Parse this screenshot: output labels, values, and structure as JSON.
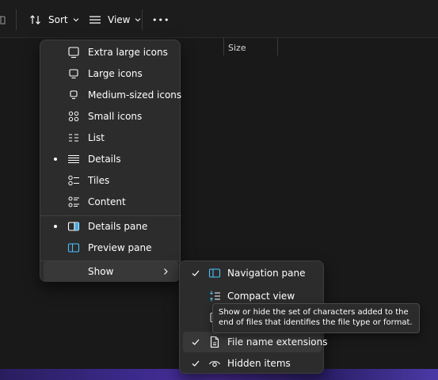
{
  "toolbar": {
    "sort_label": "Sort",
    "view_label": "View",
    "more_label": "•••"
  },
  "file_list": {
    "columns": [
      "Size"
    ]
  },
  "view_menu": {
    "items": [
      {
        "label": "Extra large icons",
        "icon": "extra-large-icons-icon",
        "selected": false
      },
      {
        "label": "Large icons",
        "icon": "large-icons-icon",
        "selected": false
      },
      {
        "label": "Medium-sized icons",
        "icon": "medium-icons-icon",
        "selected": false
      },
      {
        "label": "Small icons",
        "icon": "small-icons-icon",
        "selected": false
      },
      {
        "label": "List",
        "icon": "list-icon",
        "selected": false
      },
      {
        "label": "Details",
        "icon": "details-icon",
        "selected": true
      },
      {
        "label": "Tiles",
        "icon": "tiles-icon",
        "selected": false
      },
      {
        "label": "Content",
        "icon": "content-icon",
        "selected": false
      }
    ],
    "panes": [
      {
        "label": "Details pane",
        "icon": "details-pane-icon",
        "selected": true
      },
      {
        "label": "Preview pane",
        "icon": "preview-pane-icon",
        "selected": false
      }
    ],
    "show_label": "Show"
  },
  "show_submenu": {
    "items": [
      {
        "label": "Navigation pane",
        "icon": "navigation-pane-icon",
        "checked": true
      },
      {
        "label": "Compact view",
        "icon": "compact-view-icon",
        "checked": false
      },
      {
        "label": "",
        "icon": "item-checkboxes-icon",
        "checked": false
      },
      {
        "label": "File name extensions",
        "icon": "file-icon",
        "checked": true
      },
      {
        "label": "Hidden items",
        "icon": "eye-icon",
        "checked": true
      }
    ]
  },
  "tooltip": {
    "text": "Show or hide the set of characters added to the end of files that identifies the file type or format."
  },
  "colors": {
    "background": "#191919",
    "menu_background": "#2c2c2c",
    "accent": "#4cc2ff"
  }
}
